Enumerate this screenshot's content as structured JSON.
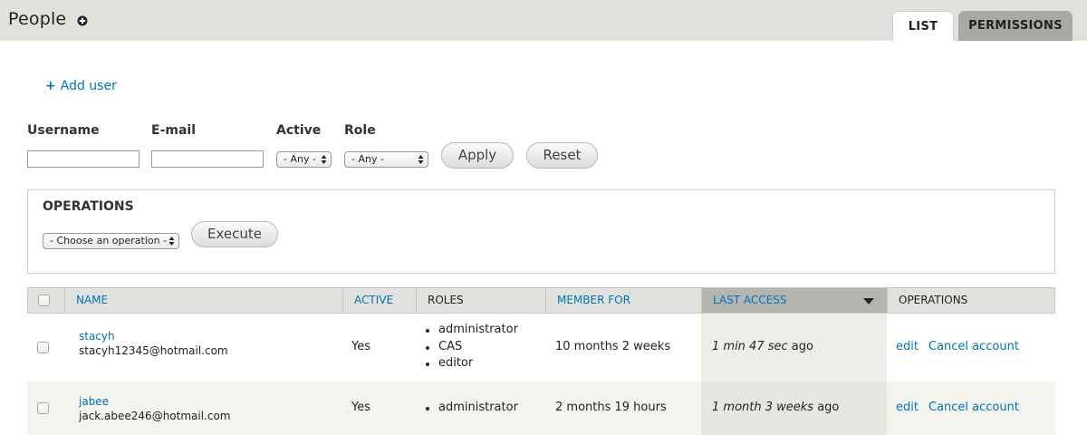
{
  "header": {
    "title": "People",
    "shortcut_icon": "plus-circle-icon",
    "tabs": [
      {
        "label": "LIST",
        "active": true
      },
      {
        "label": "PERMISSIONS",
        "active": false
      }
    ]
  },
  "actions": {
    "add_user_icon": "plus-icon",
    "add_user_label": "Add user"
  },
  "filters": {
    "username_label": "Username",
    "username_value": "",
    "email_label": "E-mail",
    "email_value": "",
    "active_label": "Active",
    "active_value": "- Any -",
    "role_label": "Role",
    "role_value": "- Any -",
    "apply_label": "Apply",
    "reset_label": "Reset"
  },
  "operations": {
    "title": "OPERATIONS",
    "select_value": "- Choose an operation -",
    "execute_label": "Execute"
  },
  "table": {
    "headers": {
      "name": "NAME",
      "active": "ACTIVE",
      "roles": "ROLES",
      "member_for": "MEMBER FOR",
      "last_access": "LAST ACCESS",
      "operations": "OPERATIONS"
    },
    "sorted_column": "last_access",
    "rows": [
      {
        "username": "stacyh",
        "email": "stacyh12345@hotmail.com",
        "active": "Yes",
        "roles": [
          "administrator",
          "CAS",
          "editor"
        ],
        "member_for": "10 months 2 weeks",
        "last_access_emph": "1 min 47 sec",
        "last_access_suffix": "ago",
        "edit_label": "edit",
        "cancel_label": "Cancel account"
      },
      {
        "username": "jabee",
        "email": "jack.abee246@hotmail.com",
        "active": "Yes",
        "roles": [
          "administrator"
        ],
        "member_for": "2 months 19 hours",
        "last_access_emph": "1 month 3 weeks",
        "last_access_suffix": "ago",
        "edit_label": "edit",
        "cancel_label": "Cancel account"
      }
    ]
  },
  "colors": {
    "link": "#0074bd",
    "header_bg": "#e1e0dc",
    "sorted_header_bg": "#b4b4b0"
  }
}
